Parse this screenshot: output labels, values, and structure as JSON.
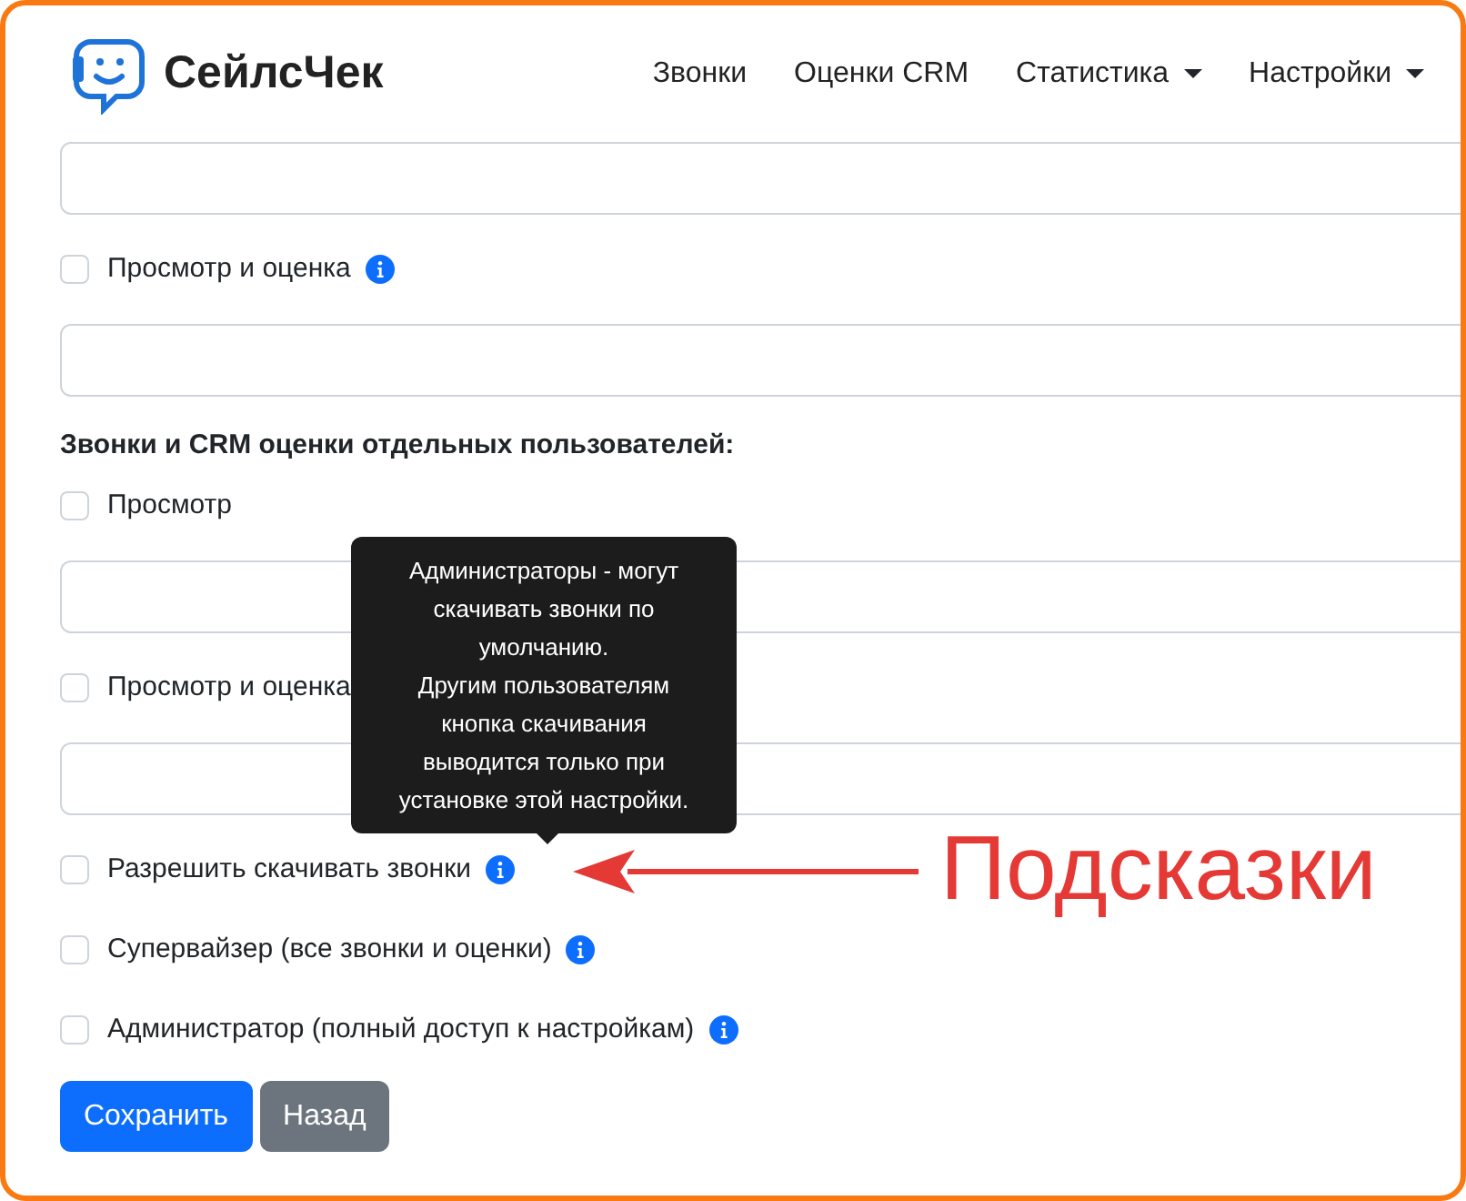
{
  "brand": {
    "name": "СейлсЧек"
  },
  "nav": [
    {
      "label": "Звонки",
      "dropdown": false
    },
    {
      "label": "Оценки CRM",
      "dropdown": false
    },
    {
      "label": "Статистика",
      "dropdown": true
    },
    {
      "label": "Настройки",
      "dropdown": true
    }
  ],
  "form": [
    {
      "kind": "input"
    },
    {
      "kind": "checkbox",
      "label": "Просмотр и оценка",
      "checked": false,
      "info": true
    },
    {
      "kind": "input"
    },
    {
      "kind": "heading",
      "label": "Звонки и CRM оценки отдельных пользователей:"
    },
    {
      "kind": "checkbox",
      "label": "Просмотр",
      "checked": false,
      "info": false
    },
    {
      "kind": "input"
    },
    {
      "kind": "checkbox",
      "label": "Просмотр и оценка",
      "checked": false
    },
    {
      "kind": "input"
    },
    {
      "kind": "checkbox",
      "label": "Разрешить скачивать звонки",
      "checked": false,
      "info": true
    },
    {
      "kind": "checkbox",
      "label": "Супервайзер (все звонки и оценки)",
      "checked": false,
      "info": true
    },
    {
      "kind": "checkbox",
      "label": "Администратор (полный доступ к настройкам)",
      "checked": false,
      "info": true
    }
  ],
  "buttons": [
    {
      "label": "Сохранить",
      "kind": "primary"
    },
    {
      "label": "Назад",
      "kind": "secondary"
    }
  ],
  "tooltip": {
    "text": "Администраторы - могут скачивать звонки по умолчанию.\nДругим пользователям кнопка скачивания выводится только при установке этой настройки."
  },
  "annotation": {
    "label": "Подсказки"
  }
}
